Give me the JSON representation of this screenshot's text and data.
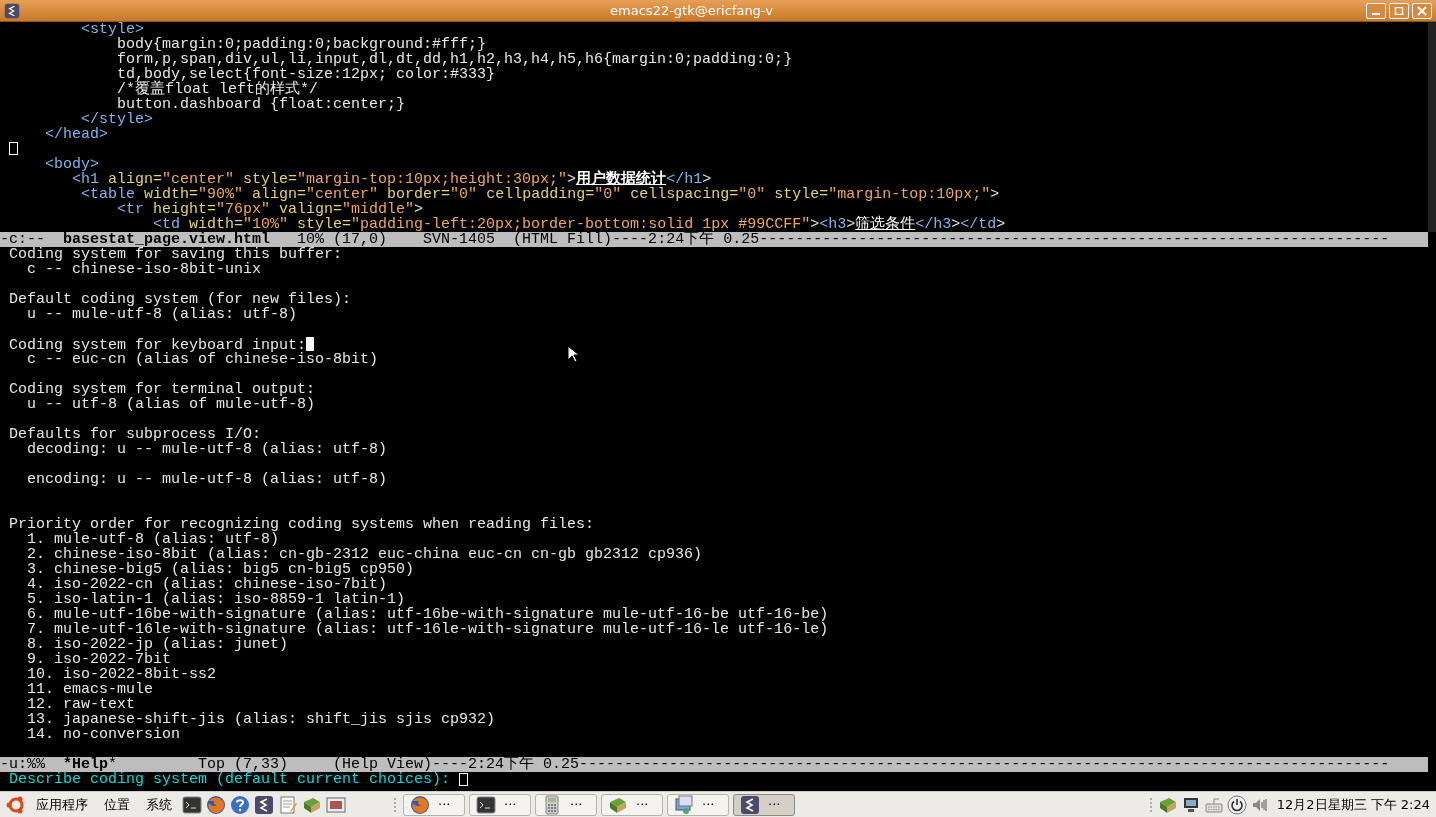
{
  "window": {
    "title": "emacs22-gtk@ericfang-v"
  },
  "code_lines": [
    {
      "kind": "code",
      "segments": [
        {
          "kind": "tag",
          "text": "        <style>"
        }
      ]
    },
    {
      "kind": "code",
      "segments": [
        {
          "kind": "text",
          "text": "            body{margin:0;padding:0;background:#fff;}"
        }
      ]
    },
    {
      "kind": "code",
      "segments": [
        {
          "kind": "text",
          "text": "            form,p,span,div,ul,li,input,dl,dt,dd,h1,h2,h3,h4,h5,h6{margin:0;padding:0;}"
        }
      ]
    },
    {
      "kind": "code",
      "segments": [
        {
          "kind": "text",
          "text": "            td,body,select{font-size:12px; color:#333}"
        }
      ]
    },
    {
      "kind": "code",
      "segments": [
        {
          "kind": "text",
          "text": "            /*覆盖float left的样式*/"
        }
      ]
    },
    {
      "kind": "code",
      "segments": [
        {
          "kind": "text",
          "text": "            button.dashboard {float:center;}"
        }
      ]
    },
    {
      "kind": "code",
      "segments": [
        {
          "kind": "tag",
          "text": "        </style>"
        }
      ]
    },
    {
      "kind": "code",
      "segments": [
        {
          "kind": "tag",
          "text": "    </head>"
        }
      ]
    },
    {
      "kind": "cursor"
    },
    {
      "kind": "code",
      "segments": [
        {
          "kind": "tag",
          "text": "    <body>"
        }
      ]
    },
    {
      "kind": "code",
      "segments": [
        {
          "kind": "tag",
          "text": "       <h1"
        },
        {
          "kind": "attr",
          "text": " align="
        },
        {
          "kind": "string",
          "text": "\"center\""
        },
        {
          "kind": "attr",
          "text": " style="
        },
        {
          "kind": "string",
          "text": "\"margin-top:10px;height:30px;\""
        },
        {
          "kind": "text",
          "text": ">"
        },
        {
          "kind": "heading",
          "text": "用户数据统计"
        },
        {
          "kind": "tag",
          "text": "</h1"
        },
        {
          "kind": "text",
          "text": ">"
        }
      ]
    },
    {
      "kind": "code",
      "segments": [
        {
          "kind": "tag",
          "text": "        <table"
        },
        {
          "kind": "attr",
          "text": " width="
        },
        {
          "kind": "string",
          "text": "\"90%\""
        },
        {
          "kind": "attr",
          "text": " align="
        },
        {
          "kind": "string",
          "text": "\"center\""
        },
        {
          "kind": "attr",
          "text": " border="
        },
        {
          "kind": "string",
          "text": "\"0\""
        },
        {
          "kind": "attr",
          "text": " cellpadding="
        },
        {
          "kind": "string",
          "text": "\"0\""
        },
        {
          "kind": "attr",
          "text": " cellspacing="
        },
        {
          "kind": "string",
          "text": "\"0\""
        },
        {
          "kind": "attr",
          "text": " style="
        },
        {
          "kind": "string",
          "text": "\"margin-top:10px;\""
        },
        {
          "kind": "text",
          "text": ">"
        }
      ]
    },
    {
      "kind": "code",
      "segments": [
        {
          "kind": "tag",
          "text": "            <tr"
        },
        {
          "kind": "attr",
          "text": " height="
        },
        {
          "kind": "string",
          "text": "\"76px\""
        },
        {
          "kind": "attr",
          "text": " valign="
        },
        {
          "kind": "string",
          "text": "\"middle\""
        },
        {
          "kind": "text",
          "text": ">"
        }
      ]
    },
    {
      "kind": "code",
      "segments": [
        {
          "kind": "tag",
          "text": "                <td"
        },
        {
          "kind": "attr",
          "text": " width="
        },
        {
          "kind": "string",
          "text": "\"10%\""
        },
        {
          "kind": "attr",
          "text": " style="
        },
        {
          "kind": "string",
          "text": "\"padding-left:20px;border-bottom:solid 1px #99CCFF\""
        },
        {
          "kind": "text",
          "text": ">"
        },
        {
          "kind": "tag",
          "text": "<h3"
        },
        {
          "kind": "text",
          "text": ">"
        },
        {
          "kind": "underlined",
          "text": "筛选条件"
        },
        {
          "kind": "tag",
          "text": "</h3"
        },
        {
          "kind": "text",
          "text": ">"
        },
        {
          "kind": "tag",
          "text": "</td"
        },
        {
          "kind": "text",
          "text": ">"
        }
      ]
    }
  ],
  "mode_line_top": "-c:--  **basestat_page.view.html**   10% (17,0)    SVN-1405  (HTML Fill)----2:24下午 0.25----------------------------------------------------------------------",
  "help_blocks": [
    {
      "lines": [
        {
          "kind": "text",
          "text": "Coding system for saving this buffer:",
          "cursor": false
        },
        {
          "kind": "text",
          "text": "  c -- chinese-iso-8bit-unix",
          "cursor": false
        },
        {
          "kind": "blank"
        },
        {
          "kind": "text",
          "text": "Default coding system (for new files):",
          "cursor": false
        },
        {
          "kind": "text",
          "text": "  u -- mule-utf-8 (alias: utf-8)",
          "cursor": false
        },
        {
          "kind": "blank"
        },
        {
          "kind": "text",
          "text": "Coding system for keyboard input:",
          "cursor": true
        },
        {
          "kind": "text",
          "text": "  c -- euc-cn (alias of chinese-iso-8bit)",
          "cursor": false
        },
        {
          "kind": "blank"
        },
        {
          "kind": "text",
          "text": "Coding system for terminal output:",
          "cursor": false
        },
        {
          "kind": "text",
          "text": "  u -- utf-8 (alias of mule-utf-8)",
          "cursor": false
        },
        {
          "kind": "blank"
        },
        {
          "kind": "text",
          "text": "Defaults for subprocess I/O:",
          "cursor": false
        },
        {
          "kind": "text",
          "text": "  decoding: u -- mule-utf-8 (alias: utf-8)",
          "cursor": false
        },
        {
          "kind": "blank"
        },
        {
          "kind": "text",
          "text": "  encoding: u -- mule-utf-8 (alias: utf-8)",
          "cursor": false
        },
        {
          "kind": "blank"
        },
        {
          "kind": "blank"
        },
        {
          "kind": "text",
          "text": "Priority order for recognizing coding systems when reading files:",
          "cursor": false
        },
        {
          "text": "  1. mule-utf-8 (alias: utf-8)",
          "cursor": false
        },
        {
          "text": "  2. chinese-iso-8bit (alias: cn-gb-2312 euc-china euc-cn cn-gb gb2312 cp936)",
          "cursor": false
        },
        {
          "text": "  3. chinese-big5 (alias: big5 cn-big5 cp950)",
          "cursor": false
        },
        {
          "text": "  4. iso-2022-cn (alias: chinese-iso-7bit)",
          "cursor": false
        },
        {
          "text": "  5. iso-latin-1 (alias: iso-8859-1 latin-1)",
          "cursor": false
        },
        {
          "text": "  6. mule-utf-16be-with-signature (alias: utf-16be-with-signature mule-utf-16-be utf-16-be)",
          "cursor": false
        },
        {
          "text": "  7. mule-utf-16le-with-signature (alias: utf-16le-with-signature mule-utf-16-le utf-16-le)",
          "cursor": false
        },
        {
          "text": "  8. iso-2022-jp (alias: junet)",
          "cursor": false
        },
        {
          "text": "  9. iso-2022-7bit",
          "cursor": false
        },
        {
          "text": "  10. iso-2022-8bit-ss2",
          "cursor": false
        },
        {
          "text": "  11. emacs-mule",
          "cursor": false
        },
        {
          "text": "  12. raw-text",
          "cursor": false
        },
        {
          "text": "  13. japanese-shift-jis (alias: shift_jis sjis cp932)",
          "cursor": false
        },
        {
          "text": "  14. no-conversion",
          "cursor": false
        }
      ]
    }
  ],
  "mode_line_bottom": "-u:%%  ***Help***         Top (7,33)     (Help View)----2:24下午 0.25------------------------------------------------------------------------------------------",
  "minibuffer": {
    "prompt": "Describe coding system (default current choices): "
  },
  "taskbar": {
    "menus": [
      "应用程序",
      "位置",
      "系统"
    ],
    "launchers": [
      {
        "kind": "terminal"
      },
      {
        "kind": "firefox"
      },
      {
        "kind": "help"
      },
      {
        "kind": "emacs"
      },
      {
        "kind": "notepad"
      },
      {
        "kind": "books"
      },
      {
        "kind": "screenshot"
      }
    ],
    "tasks": [
      {
        "kind": "firefox",
        "label": "···",
        "selected": false
      },
      {
        "kind": "terminal",
        "label": "···",
        "selected": false
      },
      {
        "kind": "calculator",
        "label": "···",
        "selected": false
      },
      {
        "kind": "books",
        "label": "···",
        "selected": false
      },
      {
        "kind": "network",
        "label": "···",
        "selected": false
      },
      {
        "kind": "emacs",
        "label": "···",
        "selected": true
      }
    ],
    "tray": [
      {
        "kind": "books"
      },
      {
        "kind": "monitor"
      },
      {
        "kind": "keyboard"
      },
      {
        "kind": "power"
      },
      {
        "kind": "volume"
      }
    ],
    "clock": "12月2日星期三 下午 2:24"
  }
}
